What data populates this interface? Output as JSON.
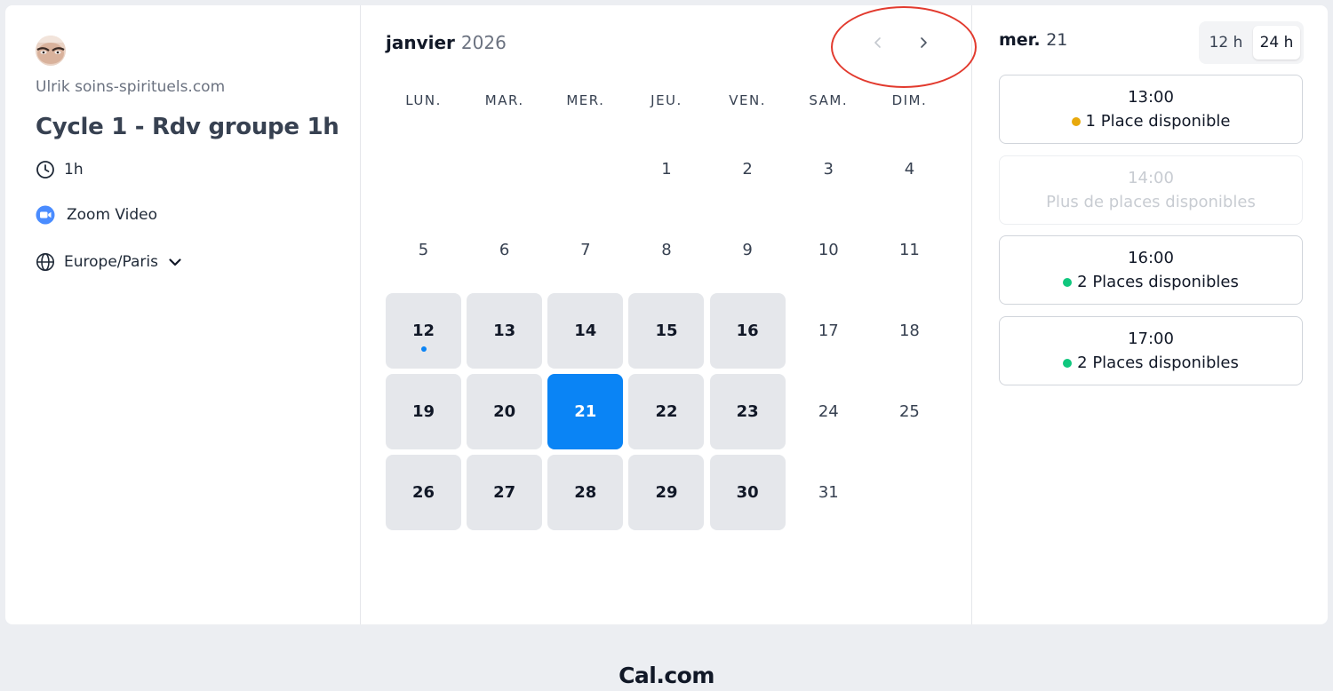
{
  "profile": {
    "name": "Ulrik soins-spirituels.com"
  },
  "event": {
    "title": "Cycle 1 - Rdv groupe 1h",
    "duration": "1h",
    "location": "Zoom Video",
    "timezone": "Europe/Paris"
  },
  "icons": {
    "duration": "clock-icon",
    "location": "zoom-video-icon",
    "timezone": "globe-icon",
    "timezone_toggle": "chevron-down-icon",
    "prev_month": "chevron-left-icon",
    "next_month": "chevron-right-icon"
  },
  "calendar": {
    "month": "janvier",
    "year": "2026",
    "weekdays": [
      "LUN.",
      "MAR.",
      "MER.",
      "JEU.",
      "VEN.",
      "SAM.",
      "DIM."
    ],
    "leading_blanks": 3,
    "days": [
      {
        "label": "1",
        "available": false
      },
      {
        "label": "2",
        "available": false
      },
      {
        "label": "3",
        "available": false
      },
      {
        "label": "4",
        "available": false
      },
      {
        "label": "5",
        "available": false
      },
      {
        "label": "6",
        "available": false
      },
      {
        "label": "7",
        "available": false
      },
      {
        "label": "8",
        "available": false
      },
      {
        "label": "9",
        "available": false
      },
      {
        "label": "10",
        "available": false
      },
      {
        "label": "11",
        "available": false
      },
      {
        "label": "12",
        "available": true,
        "today": true
      },
      {
        "label": "13",
        "available": true
      },
      {
        "label": "14",
        "available": true
      },
      {
        "label": "15",
        "available": true
      },
      {
        "label": "16",
        "available": true
      },
      {
        "label": "17",
        "available": false
      },
      {
        "label": "18",
        "available": false
      },
      {
        "label": "19",
        "available": true
      },
      {
        "label": "20",
        "available": true
      },
      {
        "label": "21",
        "available": true,
        "selected": true
      },
      {
        "label": "22",
        "available": true
      },
      {
        "label": "23",
        "available": true
      },
      {
        "label": "24",
        "available": false
      },
      {
        "label": "25",
        "available": false
      },
      {
        "label": "26",
        "available": true
      },
      {
        "label": "27",
        "available": true
      },
      {
        "label": "28",
        "available": true
      },
      {
        "label": "29",
        "available": true
      },
      {
        "label": "30",
        "available": true
      },
      {
        "label": "31",
        "available": false
      }
    ]
  },
  "selected_day": {
    "weekday": "mer.",
    "day": "21"
  },
  "time_format": {
    "options": [
      "12 h",
      "24 h"
    ],
    "active": "24 h"
  },
  "slots": [
    {
      "time": "13:00",
      "status": "1 Place disponible",
      "dot_color": "#e8a90c",
      "available": true
    },
    {
      "time": "14:00",
      "status": "Plus de places disponibles",
      "dot_color": "",
      "available": false
    },
    {
      "time": "16:00",
      "status": "2 Places disponibles",
      "dot_color": "#10c77e",
      "available": true
    },
    {
      "time": "17:00",
      "status": "2 Places disponibles",
      "dot_color": "#10c77e",
      "available": true
    }
  ],
  "colors": {
    "accent": "#0a84f5",
    "annotation_circle": "#e23a2e"
  },
  "footer": {
    "brand": "Cal.com"
  }
}
